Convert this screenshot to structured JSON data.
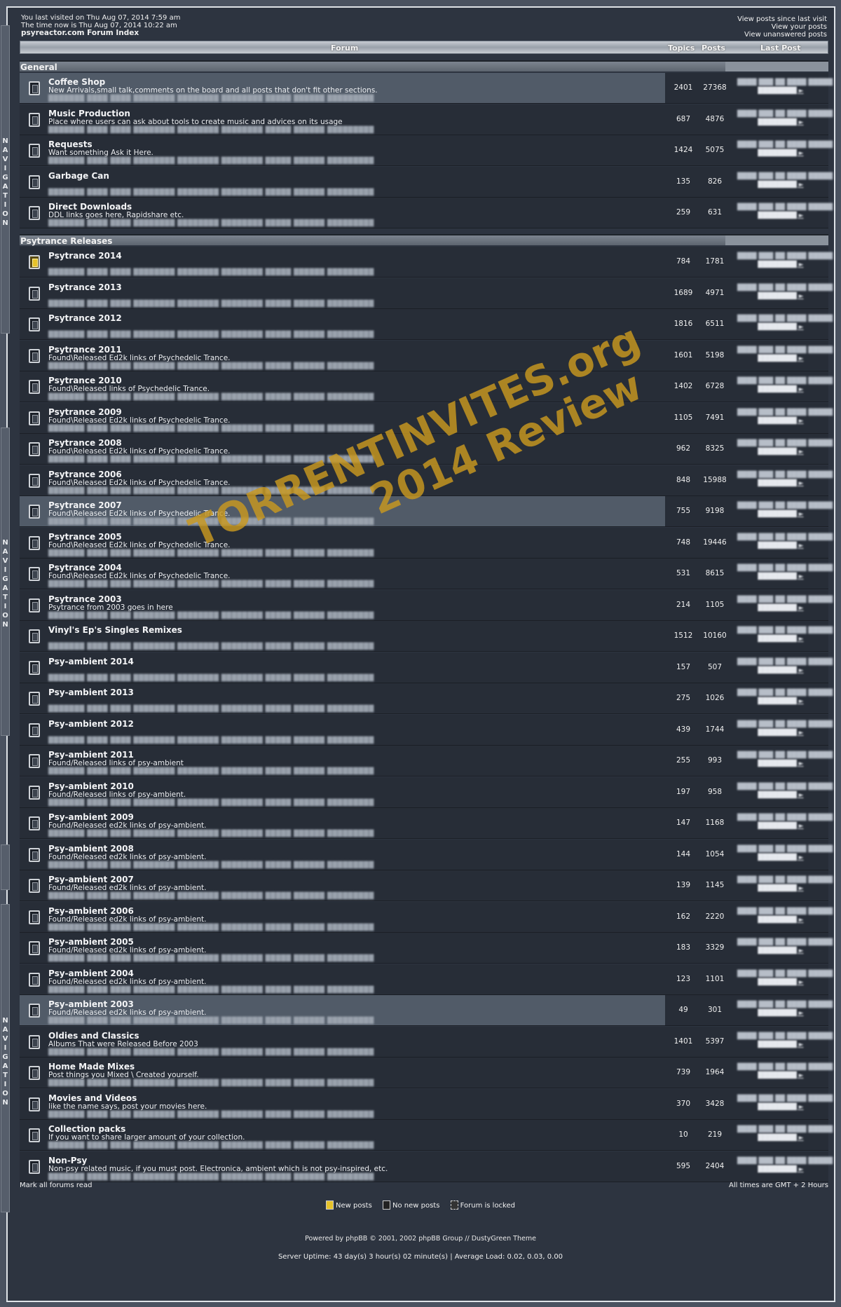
{
  "top": {
    "last_visit": "You last visited on Thu Aug 07, 2014 7:59 am",
    "time_now": "The time now is Thu Aug 07, 2014 10:22 am",
    "index_link": "psyreactor.com Forum Index",
    "links": [
      "View posts since last visit",
      "View your posts",
      "View unanswered posts"
    ]
  },
  "table_header": {
    "forum": "Forum",
    "topics": "Topics",
    "posts": "Posts",
    "last_post": "Last Post"
  },
  "nav_label": "NAVIGATION",
  "categories": [
    {
      "name": "General",
      "forums": [
        {
          "name": "Coffee Shop",
          "desc": "New Arrivals,small talk,comments on the board and all posts that don't fit other sections.",
          "topics": "2401",
          "posts": "27368",
          "status": "old",
          "highlight": true
        },
        {
          "name": "Music Production",
          "desc": "Place where users can ask about tools to create music and advices on its usage",
          "topics": "687",
          "posts": "4876",
          "status": "old"
        },
        {
          "name": "Requests",
          "desc": "Want something Ask it Here.",
          "topics": "1424",
          "posts": "5075",
          "status": "old"
        },
        {
          "name": "Garbage Can",
          "desc": "",
          "topics": "135",
          "posts": "826",
          "status": "old"
        },
        {
          "name": "Direct Downloads",
          "desc": "DDL links goes here, Rapidshare etc.",
          "topics": "259",
          "posts": "631",
          "status": "old"
        }
      ]
    },
    {
      "name": "Psytrance Releases",
      "forums": [
        {
          "name": "Psytrance 2014",
          "desc": "",
          "topics": "784",
          "posts": "1781",
          "status": "new"
        },
        {
          "name": "Psytrance 2013",
          "desc": "",
          "topics": "1689",
          "posts": "4971",
          "status": "old"
        },
        {
          "name": "Psytrance 2012",
          "desc": "",
          "topics": "1816",
          "posts": "6511",
          "status": "old"
        },
        {
          "name": "Psytrance 2011",
          "desc": "Found\\Released Ed2k links of Psychedelic Trance.",
          "topics": "1601",
          "posts": "5198",
          "status": "old"
        },
        {
          "name": "Psytrance 2010",
          "desc": "Found\\Released links of Psychedelic Trance.",
          "topics": "1402",
          "posts": "6728",
          "status": "old"
        },
        {
          "name": "Psytrance 2009",
          "desc": "Found\\Released Ed2k links of Psychedelic Trance.",
          "topics": "1105",
          "posts": "7491",
          "status": "old"
        },
        {
          "name": "Psytrance 2008",
          "desc": "Found\\Released Ed2k links of Psychedelic Trance.",
          "topics": "962",
          "posts": "8325",
          "status": "old"
        },
        {
          "name": "Psytrance 2006",
          "desc": "Found\\Released Ed2k links of Psychedelic Trance.",
          "topics": "848",
          "posts": "15988",
          "status": "old"
        },
        {
          "name": "Psytrance 2007",
          "desc": "Found\\Released Ed2k links of Psychedelic Trance.",
          "topics": "755",
          "posts": "9198",
          "status": "old",
          "highlight": true
        },
        {
          "name": "Psytrance 2005",
          "desc": "Found\\Released Ed2k links of Psychedelic Trance.",
          "topics": "748",
          "posts": "19446",
          "status": "old"
        },
        {
          "name": "Psytrance 2004",
          "desc": "Found\\Released Ed2k links of Psychedelic Trance.",
          "topics": "531",
          "posts": "8615",
          "status": "old"
        },
        {
          "name": "Psytrance 2003",
          "desc": "Psytrance from 2003 goes in here",
          "topics": "214",
          "posts": "1105",
          "status": "old"
        },
        {
          "name": "Vinyl's Ep's Singles Remixes",
          "desc": "",
          "topics": "1512",
          "posts": "10160",
          "status": "old"
        },
        {
          "name": "Psy-ambient 2014",
          "desc": "",
          "topics": "157",
          "posts": "507",
          "status": "old"
        },
        {
          "name": "Psy-ambient 2013",
          "desc": "",
          "topics": "275",
          "posts": "1026",
          "status": "old"
        },
        {
          "name": "Psy-ambient 2012",
          "desc": "",
          "topics": "439",
          "posts": "1744",
          "status": "old"
        },
        {
          "name": "Psy-ambient 2011",
          "desc": "Found/Released links of psy-ambient",
          "topics": "255",
          "posts": "993",
          "status": "old"
        },
        {
          "name": "Psy-ambient 2010",
          "desc": "Found/Released links of psy-ambient.",
          "topics": "197",
          "posts": "958",
          "status": "old"
        },
        {
          "name": "Psy-ambient 2009",
          "desc": "Found/Released ed2k links of psy-ambient.",
          "topics": "147",
          "posts": "1168",
          "status": "old"
        },
        {
          "name": "Psy-ambient 2008",
          "desc": "Found/Released ed2k links of psy-ambient.",
          "topics": "144",
          "posts": "1054",
          "status": "old"
        },
        {
          "name": "Psy-ambient 2007",
          "desc": "Found/Released ed2k links of psy-ambient.",
          "topics": "139",
          "posts": "1145",
          "status": "old"
        },
        {
          "name": "Psy-ambient 2006",
          "desc": "Found/Released ed2k links of psy-ambient.",
          "topics": "162",
          "posts": "2220",
          "status": "old"
        },
        {
          "name": "Psy-ambient 2005",
          "desc": "Found/Released ed2k links of psy-ambient.",
          "topics": "183",
          "posts": "3329",
          "status": "old"
        },
        {
          "name": "Psy-ambient 2004",
          "desc": "Found/Released ed2k links of psy-ambient.",
          "topics": "123",
          "posts": "1101",
          "status": "old"
        },
        {
          "name": "Psy-ambient 2003",
          "desc": "Found/Released ed2k links of psy-ambient.",
          "topics": "49",
          "posts": "301",
          "status": "old",
          "highlight": true
        },
        {
          "name": "Oldies and Classics",
          "desc": "Albums That were Released Before 2003",
          "topics": "1401",
          "posts": "5397",
          "status": "old"
        },
        {
          "name": "Home Made Mixes",
          "desc": "Post things you Mixed \\ Created yourself.",
          "topics": "739",
          "posts": "1964",
          "status": "old"
        },
        {
          "name": "Movies and Videos",
          "desc": "like the name says, post your movies here.",
          "topics": "370",
          "posts": "3428",
          "status": "old"
        },
        {
          "name": "Collection packs",
          "desc": "If you want to share larger amount of your collection.",
          "topics": "10",
          "posts": "219",
          "status": "old"
        },
        {
          "name": "Non-Psy",
          "desc": "Non-psy related music, if you must post. Electronica, ambient which is not psy-inspired, etc.",
          "topics": "595",
          "posts": "2404",
          "status": "old"
        }
      ]
    }
  ],
  "bottom": {
    "mark_read": "Mark all forums read",
    "timezone": "All times are GMT + 2 Hours"
  },
  "legend": {
    "new": "New posts",
    "no_new": "No new posts",
    "locked": "Forum is locked"
  },
  "footer": {
    "powered": "Powered by phpBB © 2001, 2002 phpBB Group // DustyGreen Theme",
    "uptime": "Server Uptime: 43 day(s) 3 hour(s) 02 minute(s) | Average Load: 0.02, 0.03, 0.00"
  },
  "watermark": {
    "line1": "TORRENTINVITES.org",
    "line2": "2014 Review",
    "color": "#c9981e"
  },
  "colors": {
    "page_bg": "#2d3440",
    "row_bg": "#272d37",
    "highlight_bg": "#515b68",
    "new_icon": "#e6c22a"
  }
}
